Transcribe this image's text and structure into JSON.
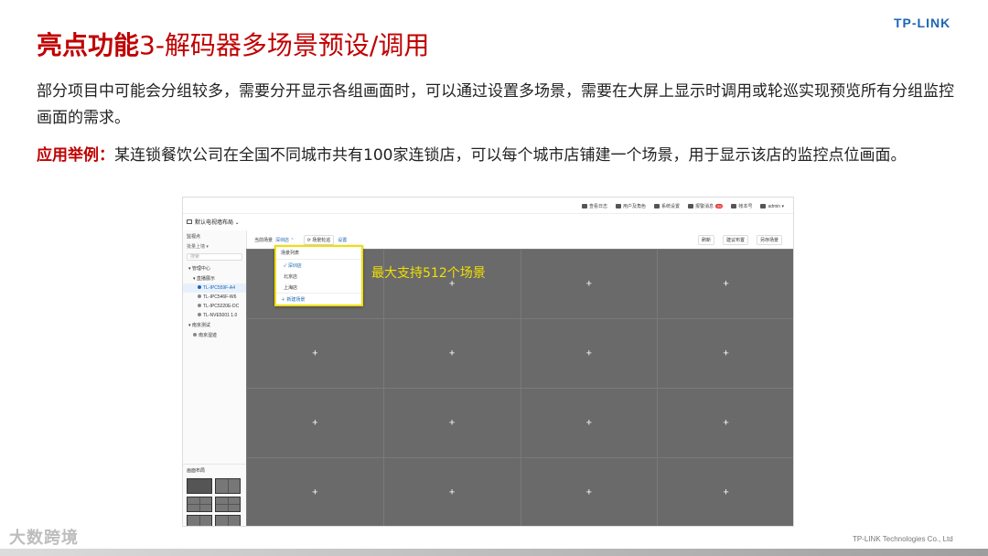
{
  "slide": {
    "title_strong": "亮点功能",
    "title_rest": "3-解码器多场景预设/调用",
    "logo": "TP-LINK",
    "paragraph1": "部分项目中可能会分组较多，需要分开显示各组画面时，可以通过设置多场景，需要在大屏上显示时调用或轮巡实现预览所有分组监控画面的需求。",
    "paragraph2_label": "应用举例：",
    "paragraph2_text": "某连锁餐饮公司在全国不同城市共有100家连锁店，可以每个城市店铺建一个场景，用于显示该店的监控点位画面。",
    "watermark": "大数跨境",
    "footer": "TP-LINK Technologies Co., Ltd"
  },
  "app": {
    "topbar": [
      {
        "icon": "monitor-icon",
        "label": "查看日志"
      },
      {
        "icon": "user-icon",
        "label": "用户及角色"
      },
      {
        "icon": "wrench-icon",
        "label": "系统设置"
      },
      {
        "icon": "bell-icon",
        "label": "报警消息",
        "badge": "99"
      },
      {
        "icon": "info-icon",
        "label": "帐本号"
      },
      {
        "icon": "person-icon",
        "label": "admin ▾"
      }
    ],
    "wall_selector": "默认电视墙布局 ⌄",
    "sidebar": {
      "heading": "监视点",
      "sub": "批量上墙 ▾",
      "search_placeholder": "搜索",
      "tree": [
        {
          "label": "▾ 管理中心",
          "indent": 0,
          "pin": false,
          "active": false
        },
        {
          "label": "▾ 直播展示",
          "indent": 1,
          "pin": false,
          "active": false
        },
        {
          "label": "TL-IPC559F-A4",
          "indent": 2,
          "pin": true,
          "active": true
        },
        {
          "label": "TL-IPC546F-W6",
          "indent": 2,
          "pin": true,
          "active": false
        },
        {
          "label": "TL-IPC5220E-DC",
          "indent": 2,
          "pin": true,
          "active": false
        },
        {
          "label": "TL-NVE5001 1.0",
          "indent": 2,
          "pin": true,
          "active": false
        },
        {
          "label": "▾ 南京测试",
          "indent": 0,
          "pin": false,
          "active": false
        },
        {
          "label": "南京湿迹",
          "indent": 1,
          "pin": true,
          "active": false
        }
      ],
      "layout_title": "画面布局"
    },
    "toolbar": {
      "scene_label": "当前场景",
      "scene_current": "深圳店 ⌃",
      "rotate_button": "⟳ 场景轮巡",
      "settings_link": "设置",
      "right_buttons": [
        "刷新",
        "建议布置",
        "另存场景"
      ]
    },
    "dropdown": {
      "header": "场景列表",
      "items": [
        {
          "label": "✓ 深圳店",
          "selected": true
        },
        {
          "label": "北京店",
          "selected": false
        },
        {
          "label": "上海店",
          "selected": false
        }
      ],
      "add": "＋ 新建场景"
    },
    "callout": "最大支持512个场景",
    "cell_plus": "+"
  }
}
